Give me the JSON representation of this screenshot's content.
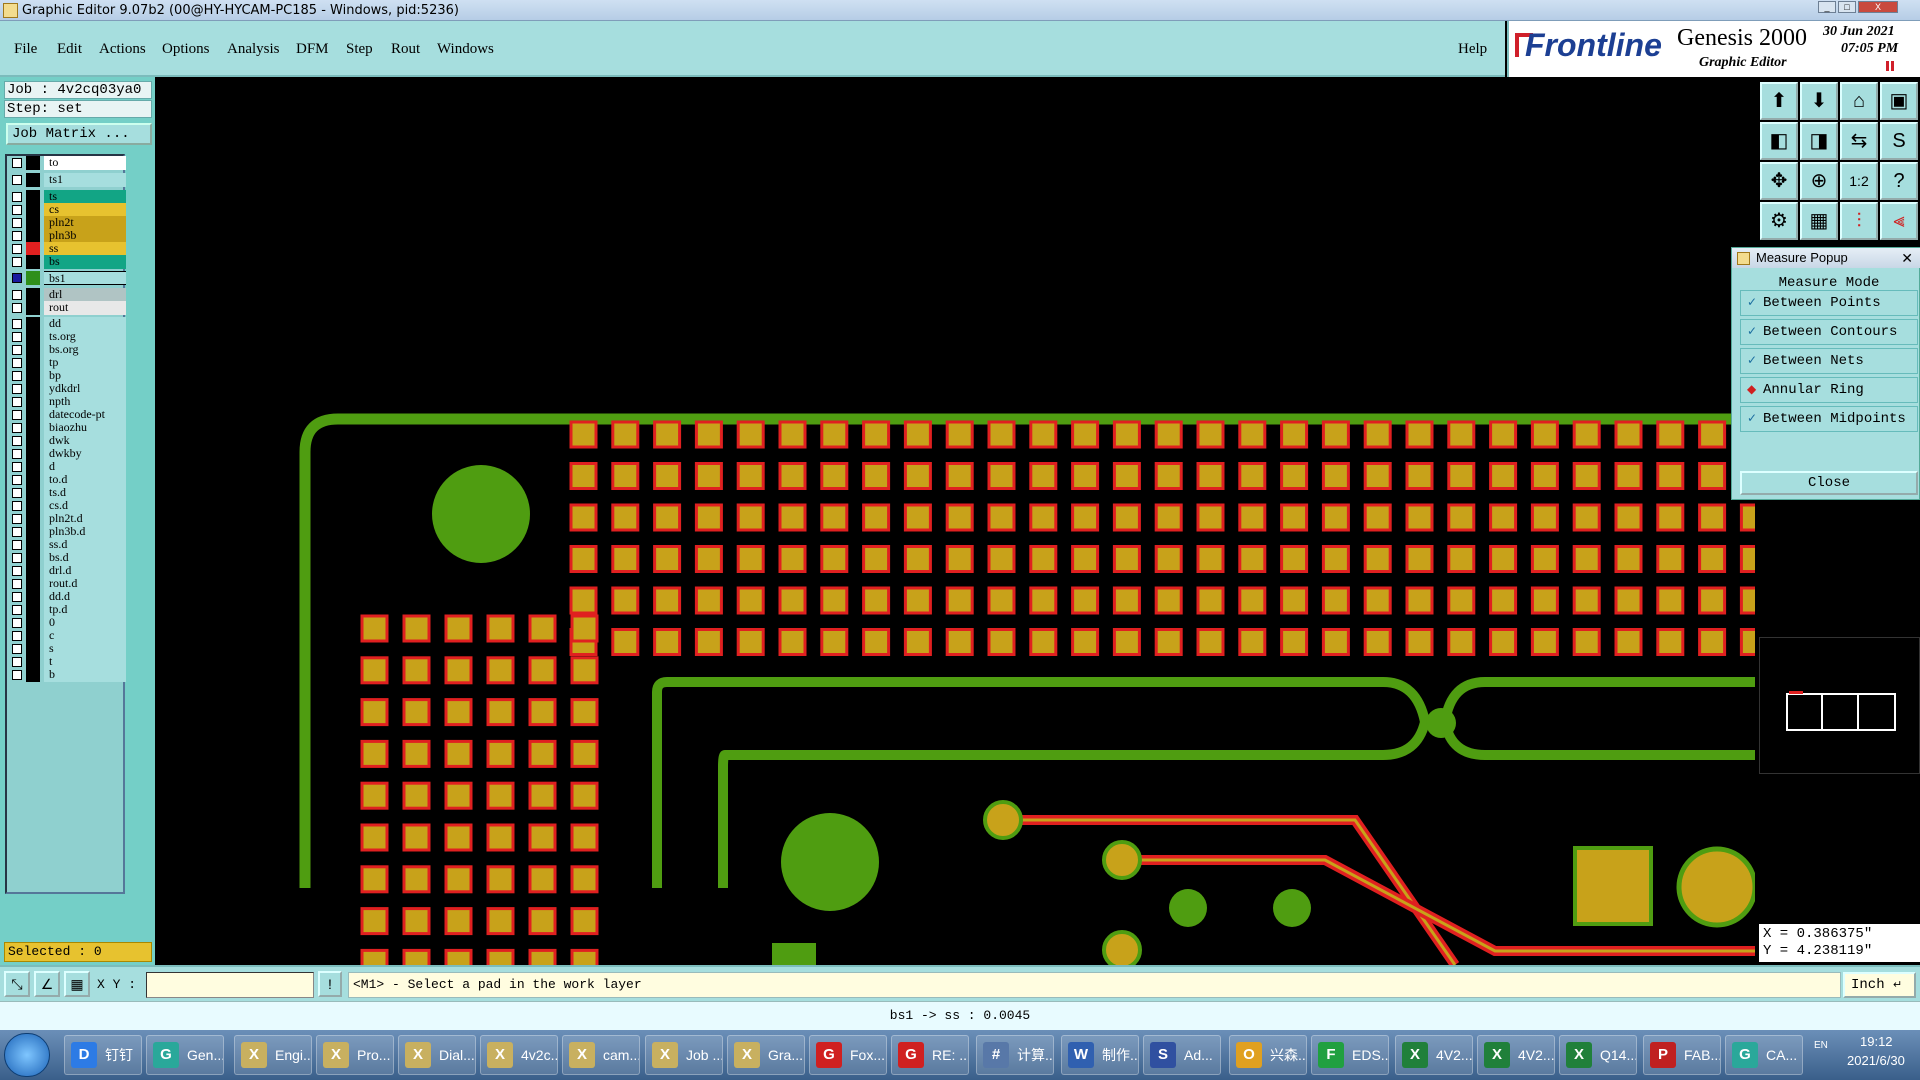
{
  "window": {
    "title": "Graphic Editor 9.07b2 (00@HY-HYCAM-PC185 - Windows, pid:5236)"
  },
  "menu": [
    "File",
    "Edit",
    "Actions",
    "Options",
    "Analysis",
    "DFM",
    "Step",
    "Rout",
    "Windows"
  ],
  "help_label": "Help",
  "brand": {
    "logo": "Frontline",
    "product": "Genesis 2000",
    "subtitle": "Graphic Editor",
    "date": "30 Jun 2021",
    "time": "07:05 PM"
  },
  "job": {
    "job_label": "Job : 4v2cq03ya0",
    "step_label": "Step: set",
    "matrix_button": "Job Matrix ..."
  },
  "layers": [
    {
      "name": "to",
      "bg": "#ffffff"
    },
    {
      "name": "ts1",
      "bg": "#a6dede"
    },
    {
      "name": "ts",
      "bg": "#12a585"
    },
    {
      "name": "cs",
      "bg": "#e7c22f"
    },
    {
      "name": "pln2t",
      "bg": "#c8a21a"
    },
    {
      "name": "pln3b",
      "bg": "#c8a21a"
    },
    {
      "name": "ss",
      "bg": "#e7c22f",
      "swatch": "#e02020"
    },
    {
      "name": "bs",
      "bg": "#12a585"
    },
    {
      "name": "bs1",
      "bg": "#a6dede",
      "swatch": "#2f8f1b",
      "active": true
    },
    {
      "name": "drl",
      "bg": "#b0c4c4"
    },
    {
      "name": "rout",
      "bg": "#e8e8e8"
    },
    {
      "name": "dd",
      "bg": "#a6dede"
    },
    {
      "name": "ts.org",
      "bg": "#a6dede"
    },
    {
      "name": "bs.org",
      "bg": "#a6dede"
    },
    {
      "name": "tp",
      "bg": "#a6dede"
    },
    {
      "name": "bp",
      "bg": "#a6dede"
    },
    {
      "name": "ydkdrl",
      "bg": "#a6dede"
    },
    {
      "name": "npth",
      "bg": "#a6dede"
    },
    {
      "name": "datecode-pt",
      "bg": "#a6dede"
    },
    {
      "name": "biaozhu",
      "bg": "#a6dede"
    },
    {
      "name": "dwk",
      "bg": "#a6dede"
    },
    {
      "name": "dwkby",
      "bg": "#a6dede"
    },
    {
      "name": "d",
      "bg": "#a6dede"
    },
    {
      "name": "to.d",
      "bg": "#a6dede"
    },
    {
      "name": "ts.d",
      "bg": "#a6dede"
    },
    {
      "name": "cs.d",
      "bg": "#a6dede"
    },
    {
      "name": "pln2t.d",
      "bg": "#a6dede"
    },
    {
      "name": "pln3b.d",
      "bg": "#a6dede"
    },
    {
      "name": "ss.d",
      "bg": "#a6dede"
    },
    {
      "name": "bs.d",
      "bg": "#a6dede"
    },
    {
      "name": "drl.d",
      "bg": "#a6dede"
    },
    {
      "name": "rout.d",
      "bg": "#a6dede"
    },
    {
      "name": "dd.d",
      "bg": "#a6dede"
    },
    {
      "name": "tp.d",
      "bg": "#a6dede"
    },
    {
      "name": "0",
      "bg": "#a6dede"
    },
    {
      "name": "c",
      "bg": "#a6dede"
    },
    {
      "name": "s",
      "bg": "#a6dede"
    },
    {
      "name": "t",
      "bg": "#a6dede"
    },
    {
      "name": "b",
      "bg": "#a6dede"
    }
  ],
  "selected": "Selected : 0",
  "measure": {
    "title": "Measure Popup",
    "heading": "Measure Mode",
    "options": [
      {
        "label": "Between Points",
        "mark": "✓"
      },
      {
        "label": "Between Contours",
        "mark": "✓"
      },
      {
        "label": "Between Nets",
        "mark": "✓"
      },
      {
        "label": "Annular Ring",
        "mark": "◆",
        "active": true
      },
      {
        "label": "Between Midpoints",
        "mark": "✓"
      }
    ],
    "close_label": "Close"
  },
  "coords": {
    "x": "X = 0.386375\"",
    "y": "Y = 4.238119\""
  },
  "command": {
    "xy_label": "X Y :",
    "xy_value": "",
    "prompt": "<M1> - Select a pad in the work layer",
    "unit": "Inch"
  },
  "status": "bs1 -> ss : 0.0045",
  "taskbar": {
    "items": [
      {
        "label": "钉钉",
        "icon": "D",
        "color": "#2d7be5"
      },
      {
        "label": "Gen...",
        "icon": "G",
        "color": "#2aa89a"
      },
      {
        "label": "Engi...",
        "icon": "X",
        "color": "#c8b060"
      },
      {
        "label": "Pro...",
        "icon": "X",
        "color": "#c8b060"
      },
      {
        "label": "Dial...",
        "icon": "X",
        "color": "#c8b060"
      },
      {
        "label": "4v2c...",
        "icon": "X",
        "color": "#c8b060"
      },
      {
        "label": "cam...",
        "icon": "X",
        "color": "#c8b060"
      },
      {
        "label": "Job ...",
        "icon": "X",
        "color": "#c8b060"
      },
      {
        "label": "Gra...",
        "icon": "X",
        "color": "#c8b060"
      },
      {
        "label": "Fox...",
        "icon": "G",
        "color": "#d02020"
      },
      {
        "label": "RE: ...",
        "icon": "G",
        "color": "#d02020"
      },
      {
        "label": "计算...",
        "icon": "#",
        "color": "#5878a8"
      },
      {
        "label": "制作...",
        "icon": "W",
        "color": "#3060b0"
      },
      {
        "label": "Ad...",
        "icon": "S",
        "color": "#3050a0"
      },
      {
        "label": "兴森...",
        "icon": "O",
        "color": "#e0a020"
      },
      {
        "label": "EDS...",
        "icon": "F",
        "color": "#20a040"
      },
      {
        "label": "4V2...",
        "icon": "X",
        "color": "#20803a"
      },
      {
        "label": "4V2...",
        "icon": "X",
        "color": "#20803a"
      },
      {
        "label": "Q14...",
        "icon": "X",
        "color": "#20803a"
      },
      {
        "label": "FAB...",
        "icon": "P",
        "color": "#c02020"
      },
      {
        "label": "CA...",
        "icon": "G",
        "color": "#2aa89a"
      }
    ],
    "time": "19:12",
    "date": "2021/6/30",
    "lang": "EN"
  },
  "colors": {
    "outline_green": "#4f9d11",
    "pad_fill": "#c8a21a",
    "pad_border": "#e02020",
    "panel_teal": "#a6dede",
    "background": "#000000"
  }
}
